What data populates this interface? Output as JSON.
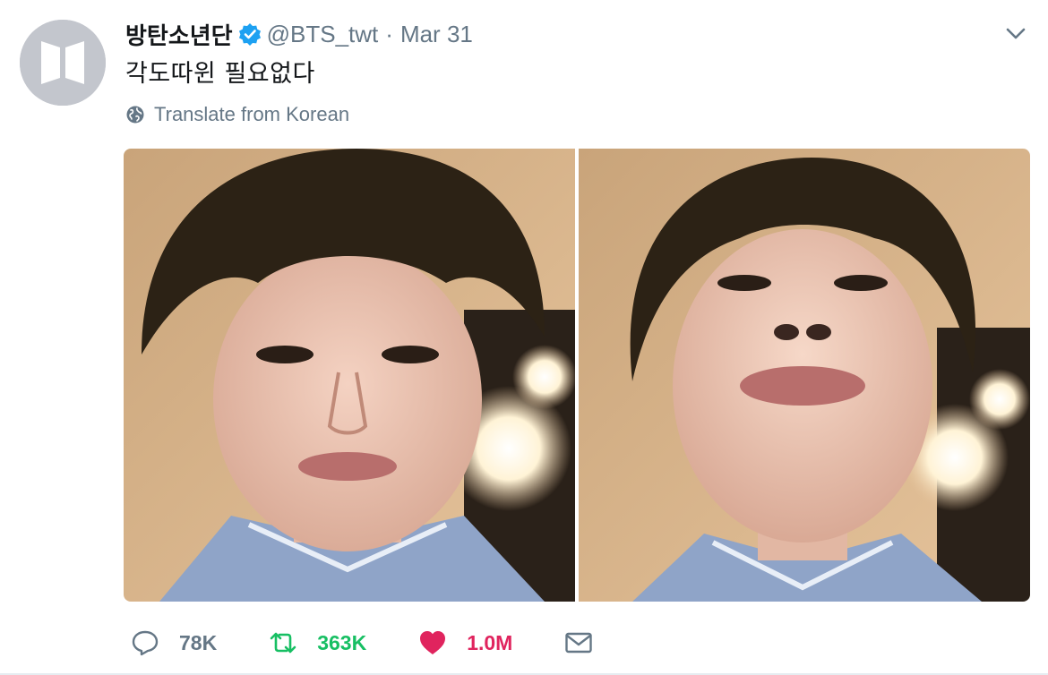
{
  "tweet": {
    "display_name": "방탄소년단",
    "handle": "@BTS_twt",
    "separator": "·",
    "date": "Mar 31",
    "text": "각도따윈 필요없다",
    "translate_label": "Translate from Korean",
    "verified": true
  },
  "actions": {
    "replies": "78K",
    "retweets": "363K",
    "likes": "1.0M"
  },
  "colors": {
    "verified": "#1da1f2",
    "muted": "#657786",
    "retweet_green": "#17bf63",
    "like_red": "#e0245e",
    "avatar_bg": "#c3c6cd"
  },
  "icons": {
    "avatar": "bts-logo-icon",
    "verified": "verified-badge-icon",
    "caret": "chevron-down-icon",
    "translate": "globe-icon",
    "reply": "reply-icon",
    "retweet": "retweet-icon",
    "like": "heart-icon",
    "dm": "envelope-icon"
  },
  "media": {
    "photo_count": 2
  }
}
